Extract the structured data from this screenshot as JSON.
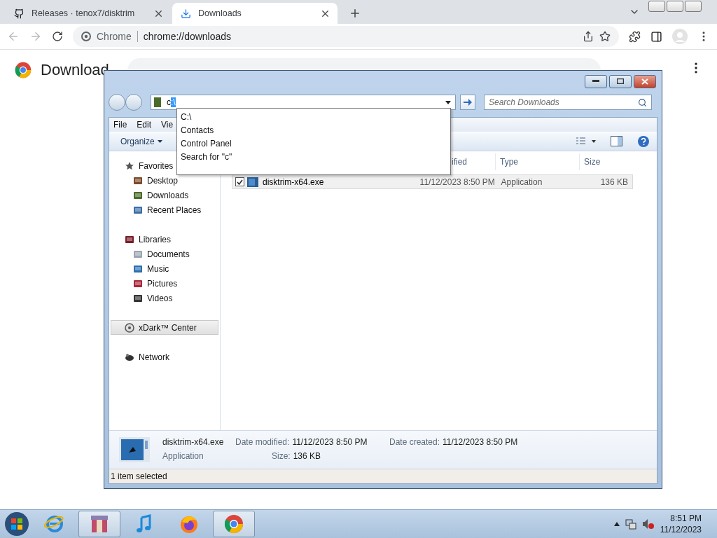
{
  "browser": {
    "tabs": [
      {
        "title": "Releases · tenox7/disktrim",
        "kind": "github",
        "selected": false
      },
      {
        "title": "Downloads",
        "kind": "download",
        "selected": true
      }
    ],
    "site_label": "Chrome",
    "url": "chrome://downloads",
    "page_title": "Download"
  },
  "explorer": {
    "address": {
      "typed": "c",
      "selected_text": ":\\"
    },
    "autocomplete": [
      "C:\\",
      "Contacts",
      "Control Panel",
      "Search for \"c\""
    ],
    "search": {
      "placeholder": "Search Downloads"
    },
    "menu": [
      "File",
      "Edit",
      "Vie"
    ],
    "organize": "Organize",
    "nav": [
      {
        "label": "Favorites",
        "kind": "star",
        "selected": false,
        "children": [
          {
            "label": "Desktop",
            "kind": "desktop",
            "selected": false
          },
          {
            "label": "Downloads",
            "kind": "downloads",
            "selected": false
          },
          {
            "label": "Recent Places",
            "kind": "recent",
            "selected": false
          }
        ]
      },
      {
        "label": "Libraries",
        "kind": "library",
        "selected": false,
        "children": [
          {
            "label": "Documents",
            "kind": "documents",
            "selected": false
          },
          {
            "label": "Music",
            "kind": "music",
            "selected": false
          },
          {
            "label": "Pictures",
            "kind": "pictures",
            "selected": false
          },
          {
            "label": "Videos",
            "kind": "videos",
            "selected": false
          }
        ]
      },
      {
        "label": "xDark™ Center",
        "kind": "center",
        "selected": true
      },
      {
        "label": "Network",
        "kind": "network",
        "selected": false
      }
    ],
    "columns": [
      "ified",
      "Type",
      "Size"
    ],
    "files": [
      {
        "name": "disktrim-x64.exe",
        "modified": "11/12/2023 8:50 PM",
        "type": "Application",
        "size": "136 KB",
        "checked": true,
        "selected": true
      }
    ],
    "details": {
      "name": "disktrim-x64.exe",
      "type": "Application",
      "modified_label": "Date modified:",
      "modified": "11/12/2023 8:50 PM",
      "created_label": "Date created:",
      "created": "11/12/2023 8:50 PM",
      "size_label": "Size:",
      "size": "136 KB"
    },
    "status": "1 item selected"
  },
  "taskbar": {
    "apps": [
      {
        "kind": "ie",
        "active": false
      },
      {
        "kind": "archive",
        "active": true
      },
      {
        "kind": "music",
        "active": false
      },
      {
        "kind": "firefox",
        "active": false
      },
      {
        "kind": "chrome",
        "active": true
      }
    ],
    "time": "8:51 PM",
    "date": "11/12/2023"
  }
}
